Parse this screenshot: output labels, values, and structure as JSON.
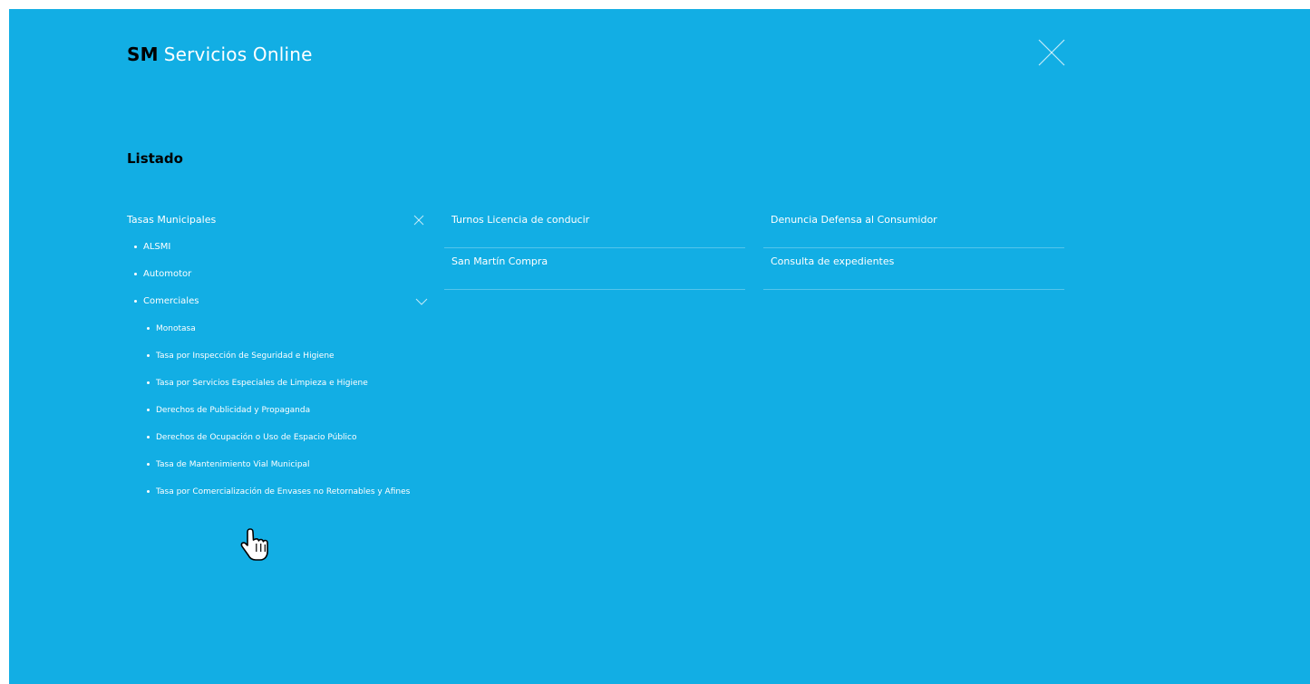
{
  "header": {
    "brand_bold": "SM",
    "brand_text": "Servicios Online"
  },
  "section": {
    "title": "Listado"
  },
  "column1": {
    "group_title": "Tasas Municipales",
    "items": [
      "ALSMI",
      "Automotor",
      "Comerciales"
    ],
    "subitems": [
      "Monotasa",
      "Tasa por Inspección de Seguridad e Higiene",
      "Tasa por Servicios Especiales de Limpieza e Higiene",
      "Derechos de Publicidad y Propaganda",
      "Derechos de Ocupación o Uso de Espacio Público",
      "Tasa de Mantenimiento Vial Municipal",
      "Tasa por Comercialización de Envases no Retornables y Afines"
    ]
  },
  "column2": {
    "items": [
      "Turnos Licencia de conducir",
      "San Martín Compra"
    ]
  },
  "column3": {
    "items": [
      "Denuncia Defensa al Consumidor",
      "Consulta de expedientes"
    ]
  },
  "colors": {
    "background": "#12aee4",
    "text": "#ffffff",
    "brand_accent": "#000000"
  },
  "icons": {
    "close": "close-icon",
    "collapse": "close-small-icon",
    "expand": "chevron-down-icon",
    "cursor": "hand-pointer-icon"
  }
}
